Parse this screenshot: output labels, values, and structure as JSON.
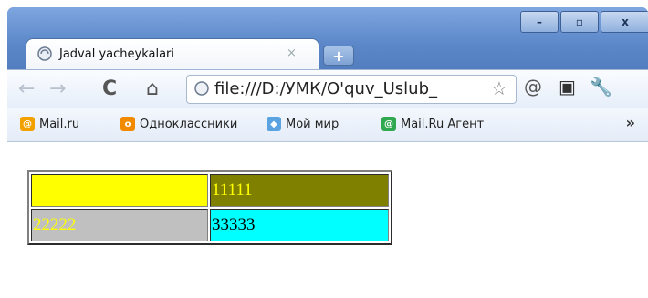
{
  "tab": {
    "title": "Jadval yacheykalari",
    "close": "×"
  },
  "newtab": "+",
  "address": {
    "url": "file:///D:/УМК/O'quv_Uslub_"
  },
  "bookmarks": {
    "items": [
      {
        "label": "Mail.ru"
      },
      {
        "label": "Одноклассники"
      },
      {
        "label": "Мой мир"
      },
      {
        "label": "Mail.Ru Агент"
      }
    ],
    "more": "»"
  },
  "table": {
    "rows": [
      {
        "cells": [
          {
            "text": "",
            "bg": "#ffff00",
            "color": "#000000"
          },
          {
            "text": "11111",
            "bg": "#808000",
            "color": "#ffff00"
          }
        ]
      },
      {
        "cells": [
          {
            "text": "22222",
            "bg": "#c0c0c0",
            "color": "#ffff00"
          },
          {
            "text": "33333",
            "bg": "#00ffff",
            "color": "#000000"
          }
        ]
      }
    ]
  }
}
